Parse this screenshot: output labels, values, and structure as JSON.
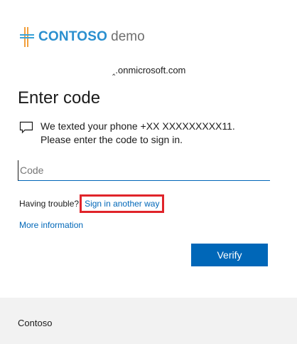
{
  "logo": {
    "brand": "CONTOSO",
    "suffix": "demo"
  },
  "account": {
    "identifier": "‸.onmicrosoft.com"
  },
  "header": {
    "title": "Enter code"
  },
  "message": {
    "icon": "chat-message-icon",
    "text": "We texted your phone +XX XXXXXXXXX11. Please enter the code to sign in."
  },
  "code_field": {
    "placeholder": "Code",
    "value": ""
  },
  "trouble": {
    "label": "Having trouble?",
    "link": "Sign in another way"
  },
  "more_info": {
    "label": "More information"
  },
  "actions": {
    "verify_label": "Verify"
  },
  "footer": {
    "text": "Contoso"
  },
  "colors": {
    "accent": "#0067b8",
    "highlight": "#e0242a",
    "footer_bg": "#f2f2f2"
  }
}
